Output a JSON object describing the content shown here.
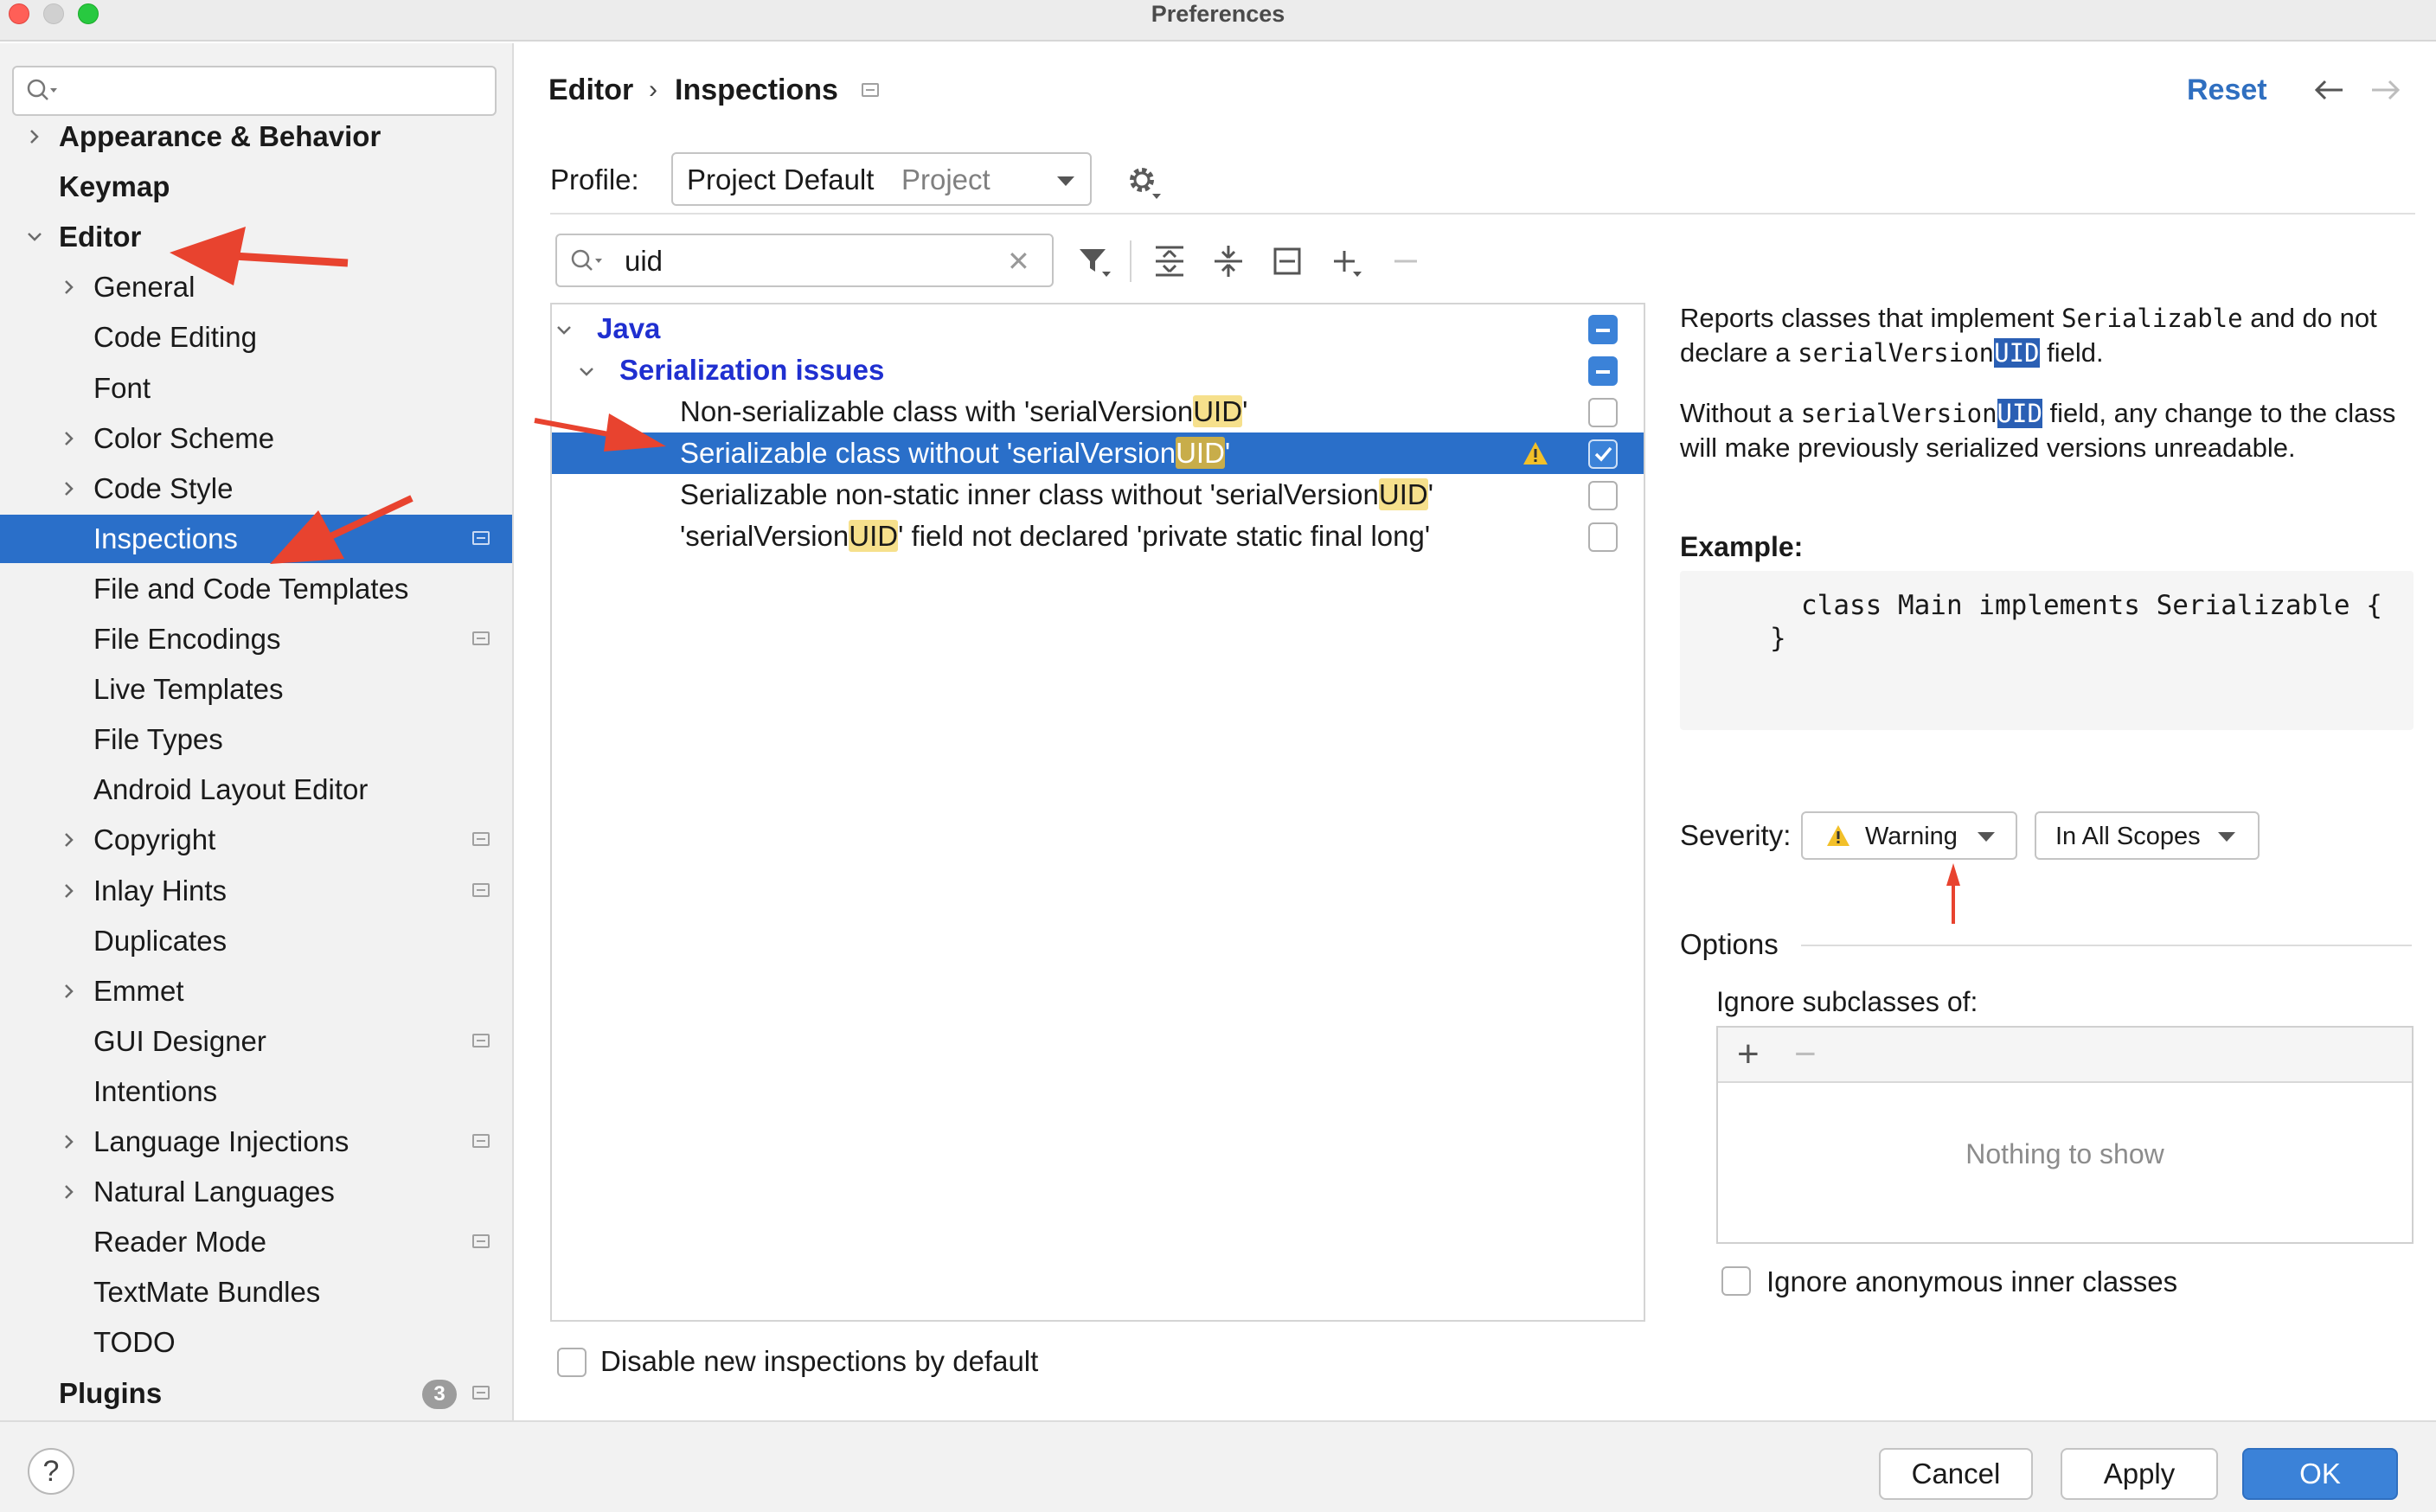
{
  "window": {
    "title": "Preferences"
  },
  "sidebar": {
    "search": {
      "placeholder": "",
      "value": ""
    },
    "items": [
      {
        "label": "Appearance & Behavior",
        "bold": true,
        "expandable": true,
        "expanded": false,
        "marker": false
      },
      {
        "label": "Keymap",
        "bold": true,
        "expandable": false,
        "marker": false
      },
      {
        "label": "Editor",
        "bold": true,
        "expandable": true,
        "expanded": true,
        "marker": false
      },
      {
        "label": "General",
        "expandable": true,
        "marker": false
      },
      {
        "label": "Code Editing",
        "expandable": false,
        "marker": false
      },
      {
        "label": "Font",
        "expandable": false,
        "marker": false
      },
      {
        "label": "Color Scheme",
        "expandable": true,
        "marker": false
      },
      {
        "label": "Code Style",
        "expandable": true,
        "marker": false
      },
      {
        "label": "Inspections",
        "expandable": false,
        "marker": true,
        "selected": true
      },
      {
        "label": "File and Code Templates",
        "expandable": false,
        "marker": false
      },
      {
        "label": "File Encodings",
        "expandable": false,
        "marker": true
      },
      {
        "label": "Live Templates",
        "expandable": false,
        "marker": false
      },
      {
        "label": "File Types",
        "expandable": false,
        "marker": false
      },
      {
        "label": "Android Layout Editor",
        "expandable": false,
        "marker": false
      },
      {
        "label": "Copyright",
        "expandable": true,
        "marker": true
      },
      {
        "label": "Inlay Hints",
        "expandable": true,
        "marker": true
      },
      {
        "label": "Duplicates",
        "expandable": false,
        "marker": false
      },
      {
        "label": "Emmet",
        "expandable": true,
        "marker": false
      },
      {
        "label": "GUI Designer",
        "expandable": false,
        "marker": true
      },
      {
        "label": "Intentions",
        "expandable": false,
        "marker": false
      },
      {
        "label": "Language Injections",
        "expandable": true,
        "marker": true
      },
      {
        "label": "Natural Languages",
        "expandable": true,
        "marker": false
      },
      {
        "label": "Reader Mode",
        "expandable": false,
        "marker": true
      },
      {
        "label": "TextMate Bundles",
        "expandable": false,
        "marker": false
      },
      {
        "label": "TODO",
        "expandable": false,
        "marker": false
      },
      {
        "label": "Plugins",
        "bold": true,
        "expandable": false,
        "marker": true,
        "badge": "3"
      }
    ]
  },
  "header": {
    "breadcrumb": [
      "Editor",
      "Inspections"
    ],
    "reset_label": "Reset"
  },
  "profile": {
    "label": "Profile:",
    "name": "Project Default",
    "scope": "Project"
  },
  "filter": {
    "value": "uid",
    "clear_icon": "close-icon"
  },
  "inspections": {
    "rows": [
      {
        "kind": "group",
        "label": "Java",
        "state": "partial"
      },
      {
        "kind": "group",
        "label": "Serialization issues",
        "state": "partial"
      },
      {
        "kind": "item",
        "pre": "Non-serializable class with 'serialVersion",
        "match": "UID",
        "post": "'",
        "state": "unchecked"
      },
      {
        "kind": "item",
        "pre": "Serializable class without 'serialVersion",
        "match": "UID",
        "post": "'",
        "state": "checked",
        "selected": true,
        "warning": true
      },
      {
        "kind": "item",
        "pre": "Serializable non-static inner class without 'serialVersion",
        "match": "UID",
        "post": "'",
        "state": "unchecked"
      },
      {
        "kind": "item",
        "pre": "'serialVersion",
        "match": "UID",
        "post": "' field not declared 'private static final long'",
        "state": "unchecked"
      }
    ]
  },
  "disable_new": {
    "label": "Disable new inspections by default",
    "checked": false
  },
  "description": {
    "p1_a": "Reports classes that implement ",
    "p1_code1": "Serializable",
    "p1_b": " and do not declare a ",
    "p1_code2": "serialVersion",
    "p1_uid": "UID",
    "p1_c": " field.",
    "p2_a": "Without a ",
    "p2_code": "serialVersion",
    "p2_uid": "UID",
    "p2_b": " field, any change to the class will make previously serialized versions unreadable.",
    "example_label": "Example:",
    "code_lines": [
      "class Main implements Serializable {",
      "}"
    ]
  },
  "severity": {
    "label": "Severity:",
    "value": "Warning",
    "scope": "In All Scopes"
  },
  "options": {
    "label": "Options",
    "ignore_label": "Ignore subclasses of:",
    "add": "+",
    "remove": "−",
    "empty": "Nothing to show",
    "anon_label": "Ignore anonymous inner classes",
    "anon_checked": false
  },
  "buttons": {
    "help": "?",
    "cancel": "Cancel",
    "apply": "Apply",
    "ok": "OK"
  },
  "colors": {
    "accent": "#2a6fc9",
    "annotation": "#e8432f",
    "highlight": "#f6e08c",
    "group_text": "#1f2fd0"
  }
}
